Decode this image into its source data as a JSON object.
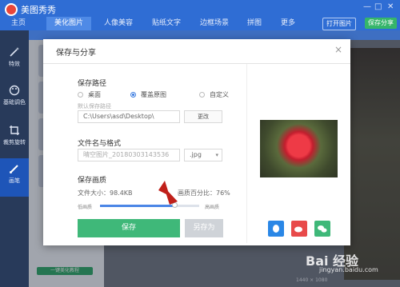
{
  "app": {
    "title": "美图秀秀"
  },
  "nav": {
    "tabs": [
      "主页",
      "美化图片",
      "人像美容",
      "贴纸文字",
      "边框场景",
      "拼图",
      "更多"
    ],
    "open_label": "打开图片",
    "save_label": "保存分享"
  },
  "sidebar": {
    "items": [
      "特效",
      "基础调色",
      "裁剪旋转",
      "画笔"
    ]
  },
  "panel": {
    "wizard_label": "一键美化教程"
  },
  "status": {
    "size_text": "1440 × 1080"
  },
  "dialog": {
    "title": "保存与分享",
    "save_path": {
      "heading": "保存路径",
      "options": [
        "桌面",
        "覆盖原图",
        "自定义"
      ],
      "default_hint": "默认保存路径",
      "path_value": "C:\\Users\\asd\\Desktop\\",
      "change_label": "更改"
    },
    "file": {
      "heading": "文件名与格式",
      "name_value": "晴空图片_20180303143536",
      "format_value": ".jpg"
    },
    "quality": {
      "heading": "保存画质",
      "size_text": "文件大小：98.4KB",
      "percent_text": "画质百分比：76%",
      "percent": 76,
      "low_label": "低画质",
      "high_label": "高画质"
    },
    "save_label": "保存",
    "save_as_label": "另存为"
  },
  "watermark": {
    "text": "Bai 经验",
    "sub": "jingyan.baidu.com"
  },
  "colors": {
    "accent": "#2f6dd4",
    "save": "#3fb879",
    "qq": "#2a87e6",
    "weibo": "#e84a4a",
    "wechat": "#3fb879"
  }
}
